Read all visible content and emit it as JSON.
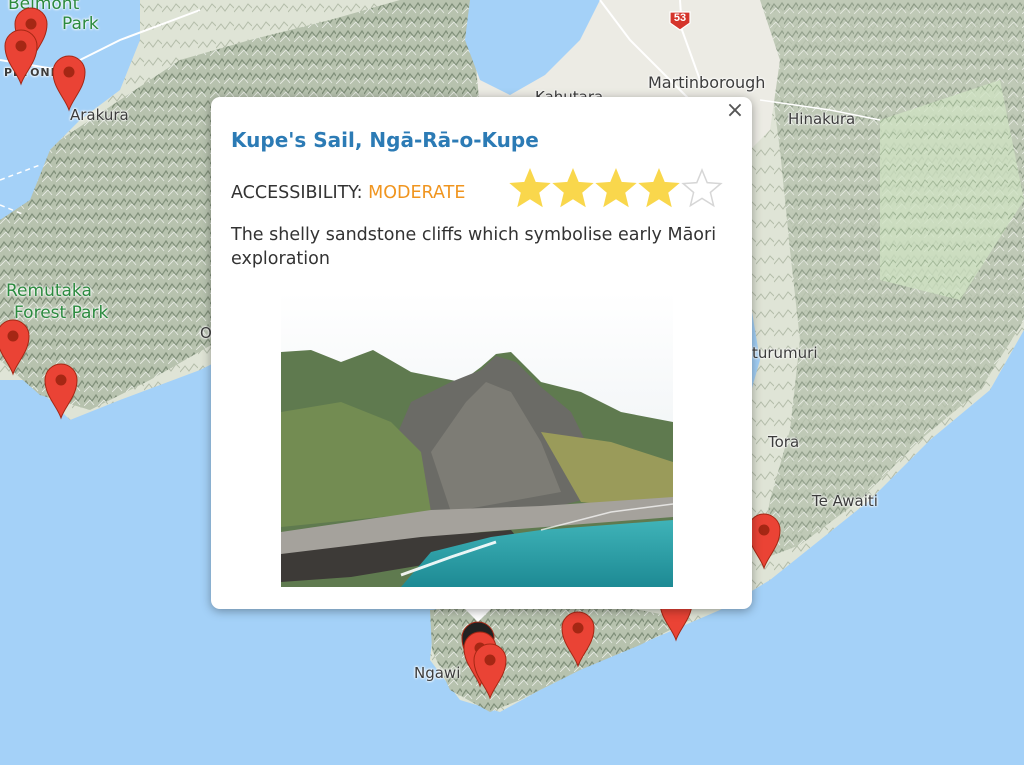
{
  "map": {
    "places": [
      {
        "id": "belmont",
        "text": "Belmont"
      },
      {
        "id": "belmont-park",
        "text": "Park"
      },
      {
        "id": "petone",
        "text": "PETONE"
      },
      {
        "id": "arakura",
        "text": "Arakura"
      },
      {
        "id": "kahutara",
        "text": "Kahutara"
      },
      {
        "id": "martinborough",
        "text": "Martinborough"
      },
      {
        "id": "hinakura",
        "text": "Hinakura"
      },
      {
        "id": "remutaka",
        "text": "Remutaka"
      },
      {
        "id": "forest-park",
        "text": "Forest Park"
      },
      {
        "id": "o-partial",
        "text": "O"
      },
      {
        "id": "pirinoa",
        "text": "turumuri"
      },
      {
        "id": "tora",
        "text": "Tora"
      },
      {
        "id": "te-awaiti",
        "text": "Te Awaiti"
      },
      {
        "id": "ngawi",
        "text": "Ngawi"
      }
    ],
    "road_shield": "53",
    "colors": {
      "water": "#a4d1f8",
      "land": "#eeeae2",
      "terrain": "#9fb09a",
      "marker": "#ea4335",
      "marker_dark": "#a52714",
      "selected_marker": "#222222"
    }
  },
  "popup": {
    "title": "Kupe's Sail, Ngā-Rā-o-Kupe",
    "accessibility_label": "ACCESSIBILITY:",
    "accessibility_value": "MODERATE",
    "rating": 4,
    "rating_max": 5,
    "description": "The shelly sandstone cliffs which symbolise early Māori exploration",
    "close_glyph": "×",
    "photo_icon": "coastal-cliffs-photo"
  }
}
